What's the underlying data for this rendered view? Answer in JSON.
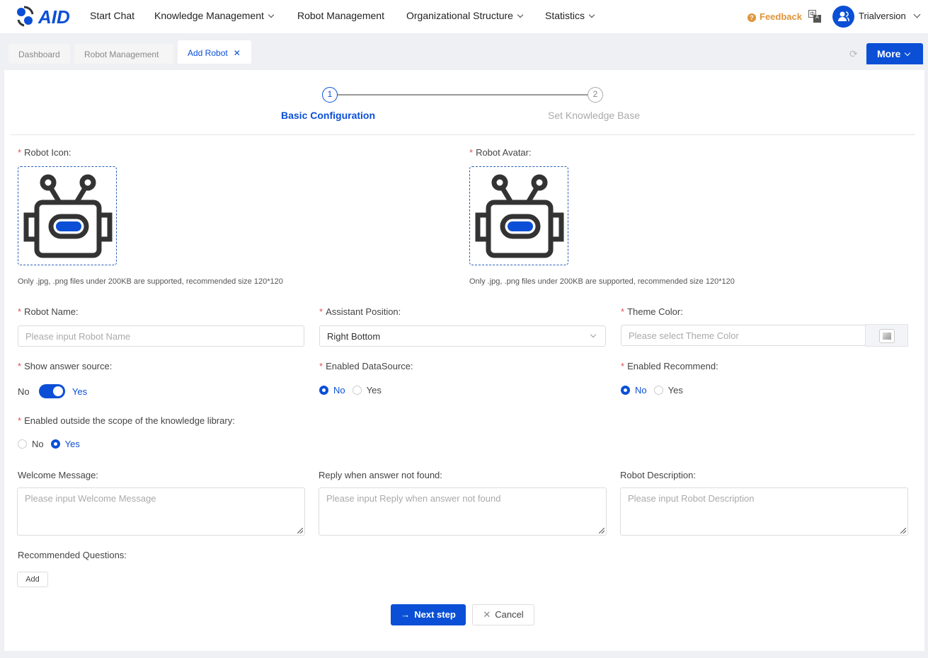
{
  "header": {
    "logo_text": "AID",
    "nav": [
      "Start Chat",
      "Knowledge Management",
      "Robot Management",
      "Organizational Structure",
      "Statistics"
    ],
    "feedback": "Feedback",
    "user": "Trialversion"
  },
  "tabs": [
    "Dashboard",
    "Robot Management",
    "Add Robot"
  ],
  "more": "More",
  "steps": [
    {
      "num": "1",
      "label": "Basic Configuration"
    },
    {
      "num": "2",
      "label": "Set Knowledge Base"
    }
  ],
  "form": {
    "robot_icon": "Robot Icon:",
    "robot_avatar": "Robot Avatar:",
    "hint": "Only .jpg, .png files under 200KB are supported, recommended size 120*120",
    "robot_name": "Robot Name:",
    "robot_name_ph": "Please input Robot Name",
    "assistant_position": "Assistant Position:",
    "assistant_position_val": "Right Bottom",
    "theme_color": "Theme Color:",
    "theme_color_ph": "Please select Theme Color",
    "show_source": "Show answer source:",
    "no": "No",
    "yes": "Yes",
    "enabled_ds": "Enabled DataSource:",
    "enabled_rec": "Enabled Recommend:",
    "outside": "Enabled outside the scope of the knowledge library:",
    "welcome": "Welcome Message:",
    "welcome_ph": "Please input Welcome Message",
    "reply": "Reply when answer not found:",
    "reply_ph": "Please input Reply when answer not found",
    "desc": "Robot Description:",
    "desc_ph": "Please input Robot Description",
    "rec_q": "Recommended Questions:",
    "add": "Add",
    "show_source_on": true,
    "enabled_ds_value": "No",
    "enabled_rec_value": "No",
    "outside_value": "Yes"
  },
  "actions": {
    "next": "Next step",
    "cancel": "Cancel"
  },
  "colors": {
    "primary": "#0a4fd6",
    "feedback": "#e0953a",
    "required": "#e34d59"
  }
}
